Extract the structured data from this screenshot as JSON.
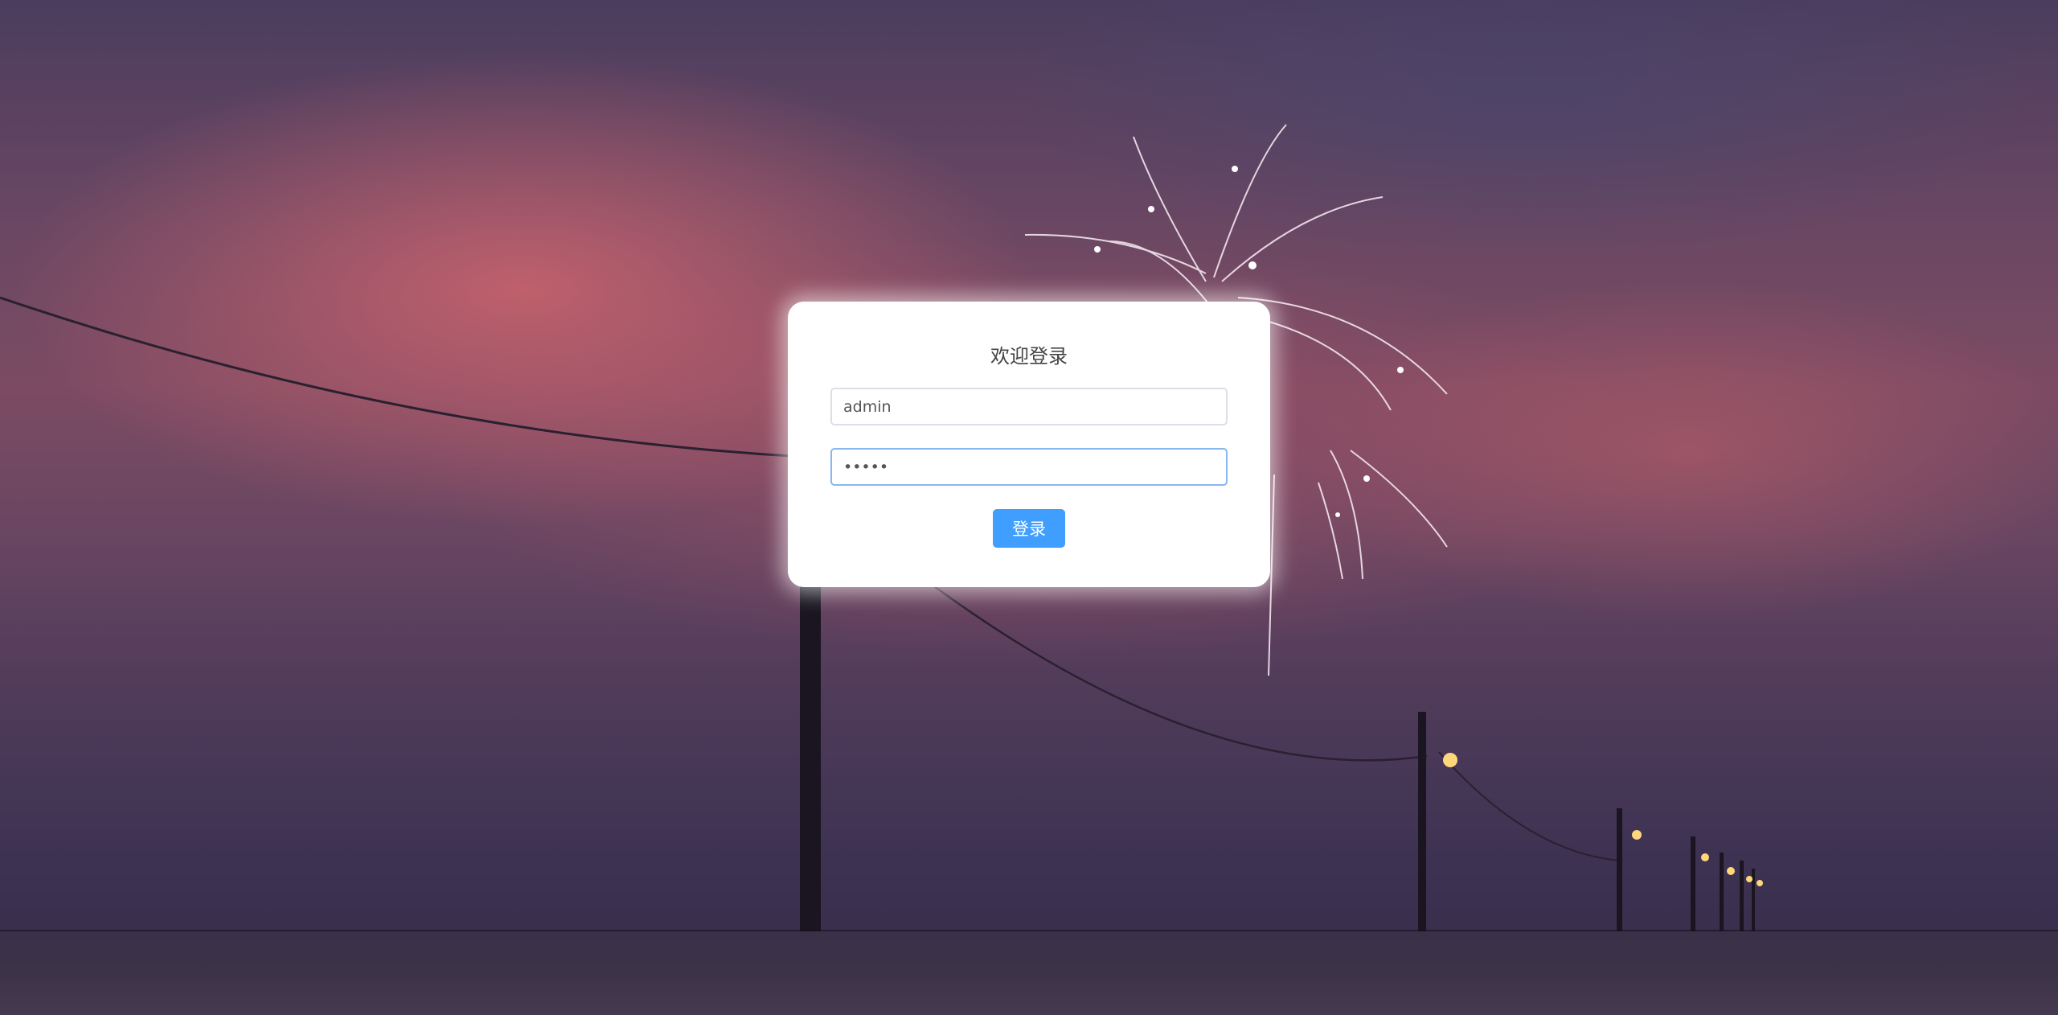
{
  "login": {
    "title": "欢迎登录",
    "username_value": "admin",
    "password_value": "•••••",
    "submit_label": "登录"
  },
  "colors": {
    "primary_button": "#409eff",
    "card_background": "#ffffff",
    "focus_border": "#8ab6ef"
  }
}
